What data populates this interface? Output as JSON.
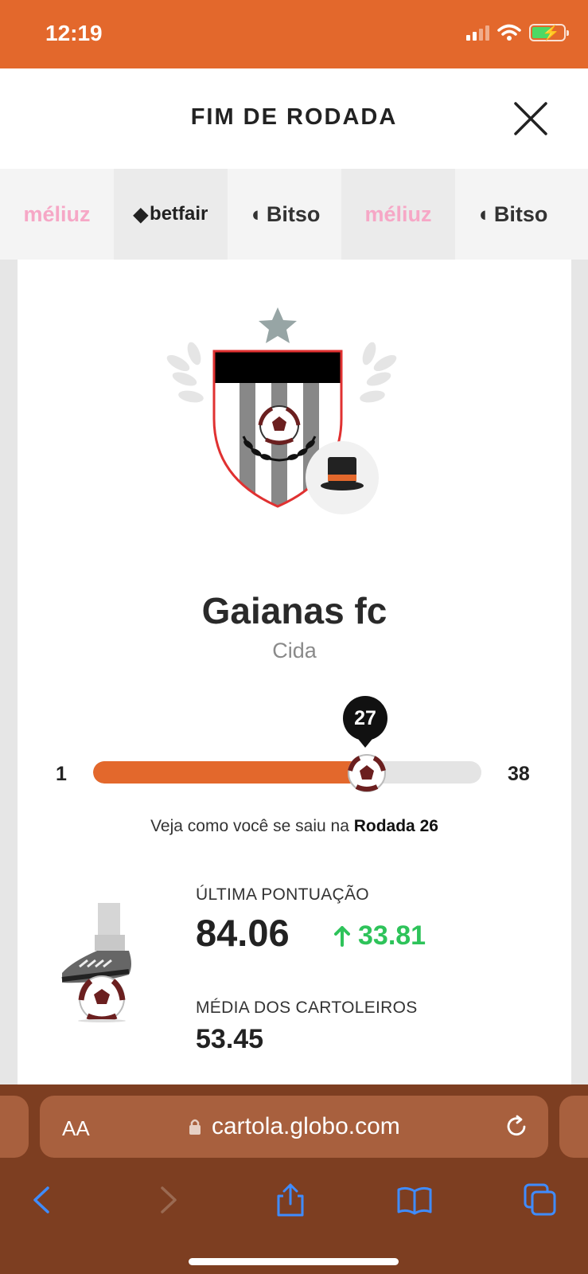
{
  "status_bar": {
    "time": "12:19"
  },
  "header": {
    "title": "FIM DE RODADA"
  },
  "sponsors": [
    "méliuz",
    "betfair",
    "Bitso",
    "méliuz",
    "Bitso"
  ],
  "team": {
    "name": "Gaianas fc",
    "owner": "Cida"
  },
  "round_progress": {
    "min": "1",
    "max": "38",
    "current": "27",
    "fraction": 0.69
  },
  "round_hint": {
    "prefix": "Veja como você se saiu na",
    "round": "Rodada 26"
  },
  "stats": {
    "last_score_label": "ÚLTIMA PONTUAÇÃO",
    "last_score": "84.06",
    "delta": "33.81",
    "average_label": "MÉDIA DOS CARTOLEIROS",
    "average": "53.45"
  },
  "browser": {
    "text_size_label": "AA",
    "url": "cartola.globo.com"
  },
  "colors": {
    "brand": "#e3682c",
    "positive": "#2ec35a",
    "browser_bg": "#7d3e21"
  },
  "icons": [
    "close-icon",
    "signal-icon",
    "wifi-icon",
    "battery-icon",
    "star-icon",
    "top-hat-icon",
    "soccer-ball-icon",
    "boot-icon",
    "arrow-up-icon",
    "lock-icon",
    "reload-icon",
    "back-icon",
    "forward-icon",
    "share-icon",
    "bookmarks-icon",
    "tabs-icon"
  ]
}
